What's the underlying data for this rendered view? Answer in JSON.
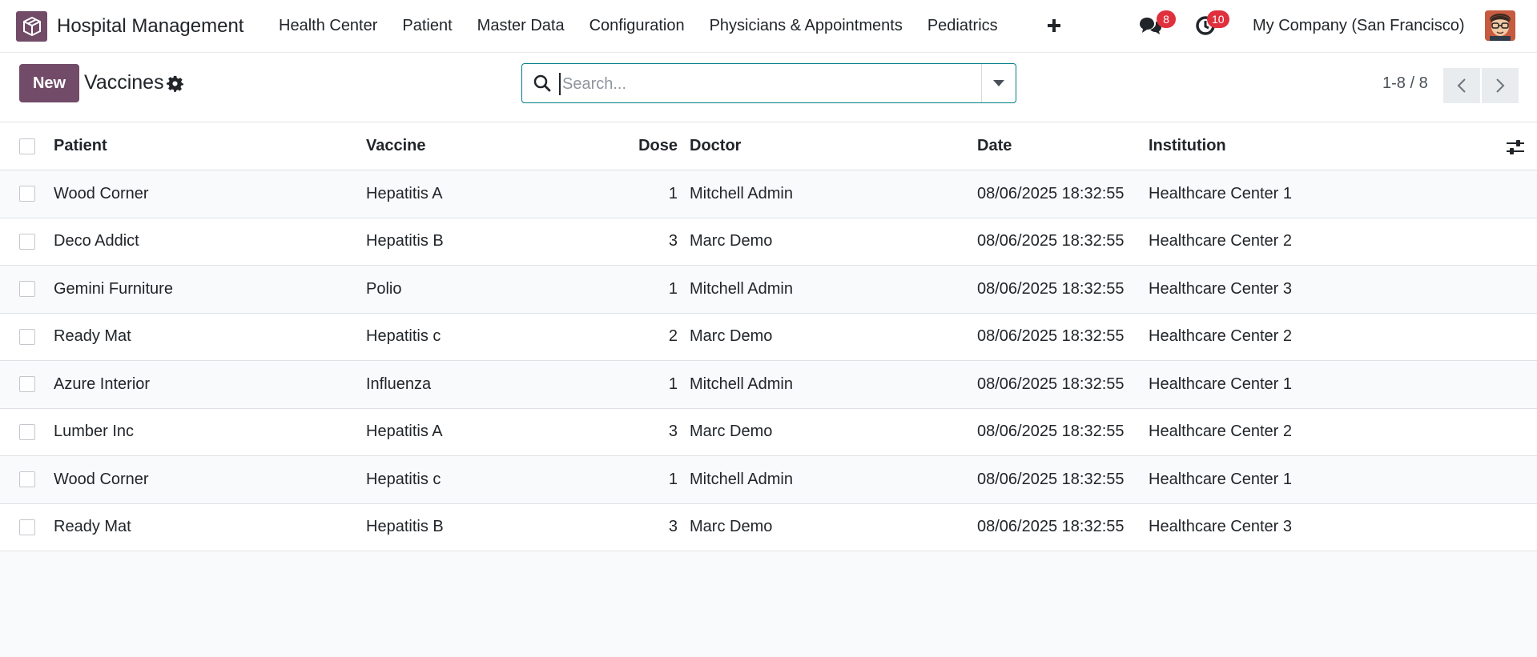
{
  "navbar": {
    "app_name": "Hospital Management",
    "menu": [
      "Health Center",
      "Patient",
      "Master Data",
      "Configuration",
      "Physicians & Appointments",
      "Pediatrics"
    ],
    "messages_count": "8",
    "activities_count": "10",
    "company": "My Company (San Francisco)"
  },
  "control_panel": {
    "new_label": "New",
    "title": "Vaccines",
    "search_placeholder": "Search...",
    "pager": "1-8 / 8"
  },
  "table": {
    "headers": {
      "patient": "Patient",
      "vaccine": "Vaccine",
      "dose": "Dose",
      "doctor": "Doctor",
      "date": "Date",
      "institution": "Institution"
    },
    "rows": [
      {
        "patient": "Wood Corner",
        "vaccine": "Hepatitis A",
        "dose": "1",
        "doctor": "Mitchell Admin",
        "date": "08/06/2025 18:32:55",
        "institution": "Healthcare Center 1"
      },
      {
        "patient": "Deco Addict",
        "vaccine": "Hepatitis B",
        "dose": "3",
        "doctor": "Marc Demo",
        "date": "08/06/2025 18:32:55",
        "institution": "Healthcare Center 2"
      },
      {
        "patient": "Gemini Furniture",
        "vaccine": "Polio",
        "dose": "1",
        "doctor": "Mitchell Admin",
        "date": "08/06/2025 18:32:55",
        "institution": "Healthcare Center 3"
      },
      {
        "patient": "Ready Mat",
        "vaccine": "Hepatitis c",
        "dose": "2",
        "doctor": "Marc Demo",
        "date": "08/06/2025 18:32:55",
        "institution": "Healthcare Center 2"
      },
      {
        "patient": "Azure Interior",
        "vaccine": "Influenza",
        "dose": "1",
        "doctor": "Mitchell Admin",
        "date": "08/06/2025 18:32:55",
        "institution": "Healthcare Center 1"
      },
      {
        "patient": "Lumber Inc",
        "vaccine": "Hepatitis A",
        "dose": "3",
        "doctor": "Marc Demo",
        "date": "08/06/2025 18:32:55",
        "institution": "Healthcare Center 2"
      },
      {
        "patient": "Wood Corner",
        "vaccine": "Hepatitis c",
        "dose": "1",
        "doctor": "Mitchell Admin",
        "date": "08/06/2025 18:32:55",
        "institution": "Healthcare Center 1"
      },
      {
        "patient": "Ready Mat",
        "vaccine": "Hepatitis B",
        "dose": "3",
        "doctor": "Marc Demo",
        "date": "08/06/2025 18:32:55",
        "institution": "Healthcare Center 3"
      }
    ]
  },
  "colors": {
    "brand": "#714b67",
    "search_focus": "#017e84",
    "badge": "#e0303d"
  },
  "icons": [
    "app-logo-icon",
    "plus-icon",
    "chat-icon",
    "clock-icon",
    "gear-icon",
    "search-icon",
    "caret-down-icon",
    "chevron-left-icon",
    "chevron-right-icon",
    "column-options-icon"
  ]
}
